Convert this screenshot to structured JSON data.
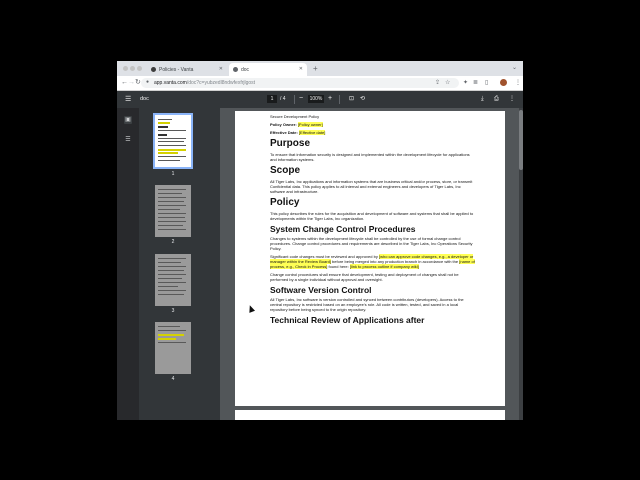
{
  "browser": {
    "tabs": [
      {
        "title": "Policies - Vanta",
        "active": false,
        "favicon_color": "#3d3d3d"
      },
      {
        "title": "doc",
        "active": true,
        "favicon_color": "#5f6368"
      }
    ],
    "new_tab": "+",
    "tab_menu": "⌄",
    "url_domain": "app.vanta.com",
    "url_path": "/doc?c=yubzedl8ndwfexfrjlgost",
    "nav": {
      "back": "←",
      "forward": "→",
      "reload": "↻"
    },
    "toolbar_icons": {
      "share": "⇪",
      "bookmark": "☆",
      "extensions": "✦",
      "reading_list": "≣",
      "side_panel": "▯",
      "menu": "⋮"
    }
  },
  "pdf_toolbar": {
    "menu_glyph": "☰",
    "title": "doc",
    "current_page": "1",
    "page_total": "/  4",
    "zoom_out": "−",
    "zoom": "100%",
    "zoom_in": "+",
    "fit_glyph": "⊡",
    "rotate_glyph": "⟲",
    "download_glyph": "⤓",
    "print_glyph": "⎙",
    "more_glyph": "⋮"
  },
  "sidebar": {
    "thumbnail_icon": "▣",
    "outline_icon": "☰",
    "thumbnails": [
      "1",
      "2",
      "3",
      "4"
    ]
  },
  "document": {
    "doc_title": "Secure Development Policy",
    "owner_label": "Policy Owner:",
    "owner_value": "[Policy owner]",
    "date_label": "Effective Date:",
    "date_value": "[Effective date]",
    "sections": {
      "purpose_h": "Purpose",
      "purpose_p": "To ensure that information security is designed and implemented within the development lifecycle for applications and information systems.",
      "scope_h": "Scope",
      "scope_p": "All Tiger Labs, Inc applications and information systems that are business critical and/or process, store, or transmit Confidential data. This policy applies to all internal and external engineers and developers of Tiger Labs, Inc software and infrastructure.",
      "policy_h": "Policy",
      "policy_p": "This policy describes the rules for the acquisition and development of software and systems that shall be applied to developments within the Tiger Labs, Inc organization.",
      "scc_h": "System Change Control Procedures",
      "scc_p1": "Changes to systems within the development lifecycle shall be controlled by the use of formal change control procedures. Change control procedures and requirements are described in the Tiger Labs, Inc Operations Security Policy.",
      "scc_p2_a": "Significant code changes must be reviewed and approved by ",
      "scc_p2_hl1": "[who can approve code changes, e.g., a developer or manager within the Review Board]",
      "scc_p2_b": " before being merged into any production branch in accordance with the ",
      "scc_p2_hl2": "[name of process, e.g., Check in Process]",
      "scc_p2_c": " found here: ",
      "scc_p2_hl3": "[link to process outline if company wiki]",
      "scc_p3": "Change control procedures shall ensure that development, testing and deployment of changes shall not be performed by a single individual without approval and oversight.",
      "svc_h": "Software Version Control",
      "svc_p": "All Tiger Labs, Inc software is version controlled and synced between contributors (developers). Access to the central repository is restricted based on an employee's role. All code is written, tested, and saved in a local repository before being synced to the origin repository.",
      "tech_h": "Technical Review of Applications after"
    }
  },
  "colors": {
    "highlight": "#ffff55",
    "toolbar": "#323639",
    "viewer_bg": "#525659",
    "selection": "#8ab4f8"
  }
}
